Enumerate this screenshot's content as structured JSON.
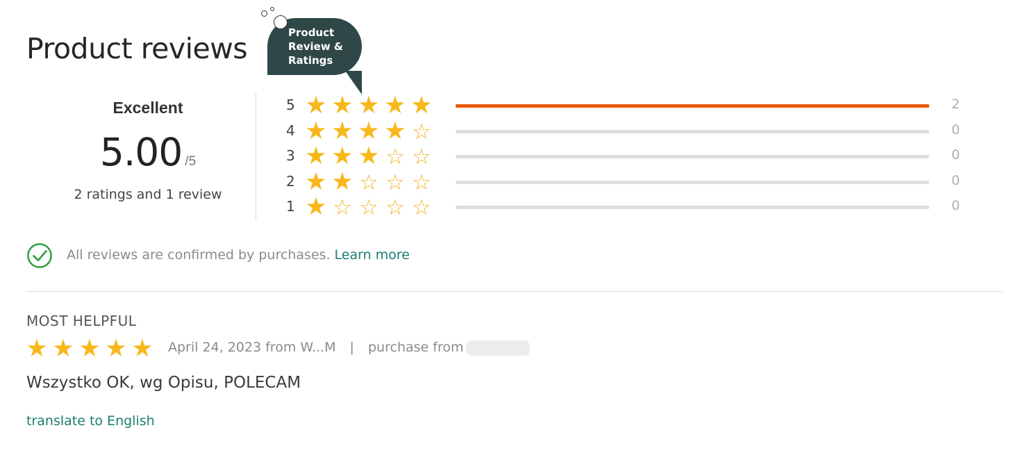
{
  "header": {
    "title": "Product reviews"
  },
  "callout": {
    "text": "Product Review & Ratings"
  },
  "summary": {
    "verdict": "Excellent",
    "score": "5.00",
    "out_of": "/5",
    "count_text": "2 ratings and 1 review"
  },
  "breakdown": [
    {
      "stars": "5",
      "count": "2",
      "fraction": 1.0
    },
    {
      "stars": "4",
      "count": "0",
      "fraction": 0
    },
    {
      "stars": "3",
      "count": "0",
      "fraction": 0
    },
    {
      "stars": "2",
      "count": "0",
      "fraction": 0
    },
    {
      "stars": "1",
      "count": "0",
      "fraction": 0
    }
  ],
  "confirmation": {
    "text": "All reviews are confirmed by purchases.",
    "link": "Learn more"
  },
  "review": {
    "section_label": "MOST HELPFUL",
    "rating": 5,
    "date_author": "April 24, 2023 from W...M",
    "separator": "|",
    "purchase_label": "purchase from",
    "text": "Wszystko OK, wg Opisu, POLECAM",
    "translate_link": "translate to English"
  },
  "colors": {
    "star": "#f8b81c",
    "bar_fill": "#ec5b0b",
    "bar_track": "#dedede",
    "link": "#1c7d6f",
    "callout_bg": "#2f4747",
    "check": "#2e9e3f"
  },
  "icons": {
    "star_full": "star-icon",
    "star_empty": "star-outline-icon",
    "confirm": "check-circle-icon"
  }
}
